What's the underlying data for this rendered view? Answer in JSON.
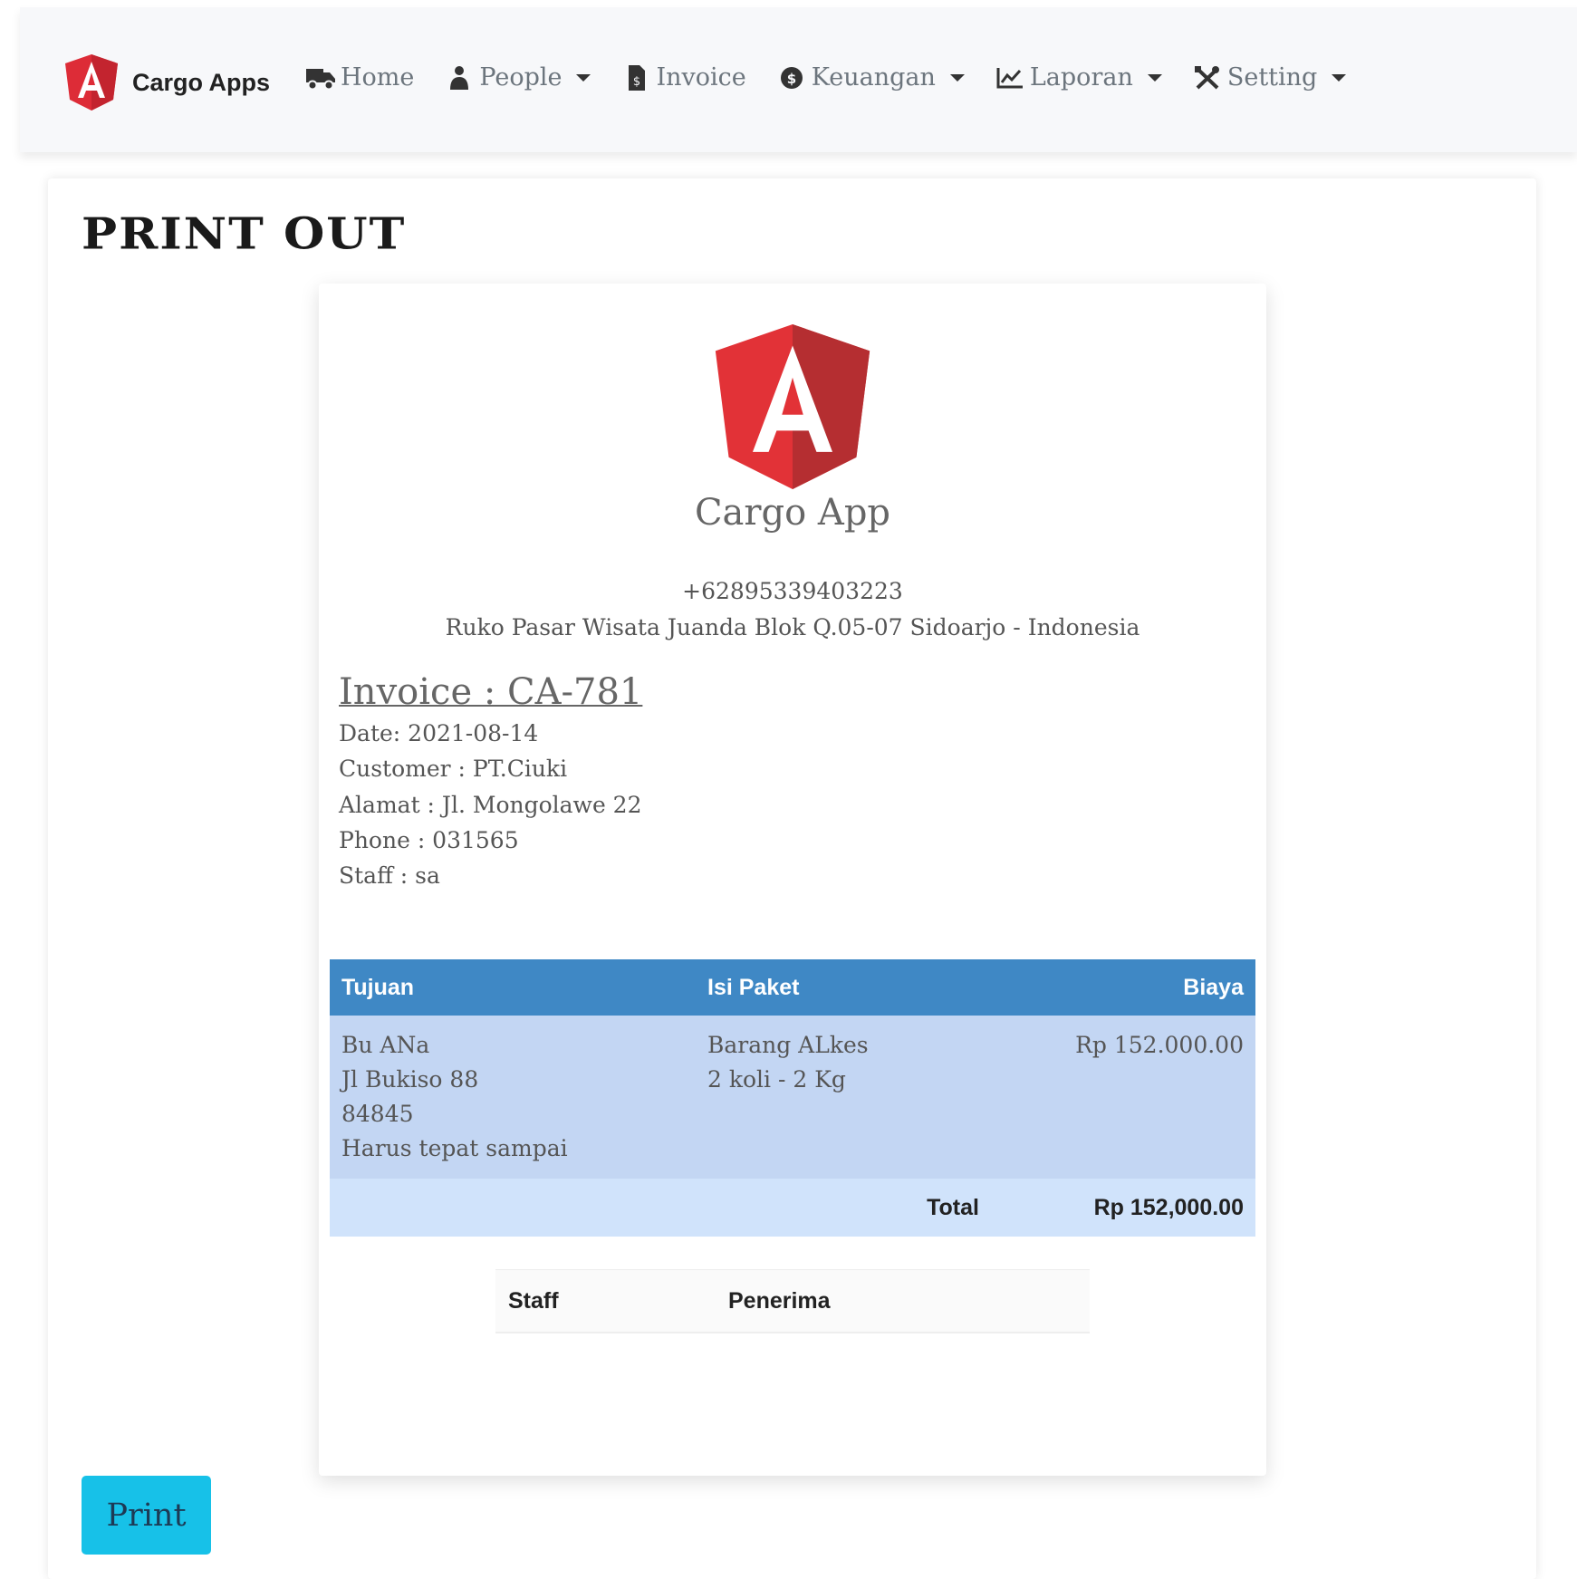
{
  "nav": {
    "brand": "Cargo Apps",
    "items": [
      {
        "label": "Home",
        "icon": "truck-icon",
        "dropdown": false
      },
      {
        "label": "People",
        "icon": "user-icon",
        "dropdown": true
      },
      {
        "label": "Invoice",
        "icon": "file-invoice-icon",
        "dropdown": false
      },
      {
        "label": "Keuangan",
        "icon": "money-icon",
        "dropdown": true
      },
      {
        "label": "Laporan",
        "icon": "chart-line-icon",
        "dropdown": true
      },
      {
        "label": "Setting",
        "icon": "tools-icon",
        "dropdown": true
      }
    ]
  },
  "page": {
    "title": "PRINT OUT"
  },
  "company": {
    "name": "Cargo App",
    "phone": "+62895339403223",
    "address": "Ruko Pasar Wisata Juanda Blok Q.05-07 Sidoarjo - Indonesia"
  },
  "invoice": {
    "title": "Invoice : CA-781",
    "date": "Date: 2021-08-14",
    "customer": "Customer : PT.Ciuki",
    "alamat": "Alamat : Jl. Mongolawe 22",
    "phone": "Phone : 031565",
    "staff": "Staff : sa"
  },
  "table": {
    "headers": {
      "tujuan": "Tujuan",
      "isi_paket": "Isi Paket",
      "biaya": "Biaya"
    },
    "row": {
      "tujuan": [
        "Bu ANa",
        "Jl Bukiso 88",
        "84845",
        "Harus tepat sampai"
      ],
      "isi_paket": [
        "Barang ALkes",
        "2 koli - 2 Kg"
      ],
      "biaya": "Rp 152.000.00"
    },
    "total_label": "Total",
    "total_value": "Rp 152,000.00"
  },
  "signature": {
    "staff": "Staff",
    "penerima": "Penerima"
  },
  "actions": {
    "print": "Print"
  },
  "colors": {
    "accent": "#3f88c5",
    "row": "#c3d6f3",
    "button": "#17c1e8",
    "logo_red": "#dd3333"
  }
}
